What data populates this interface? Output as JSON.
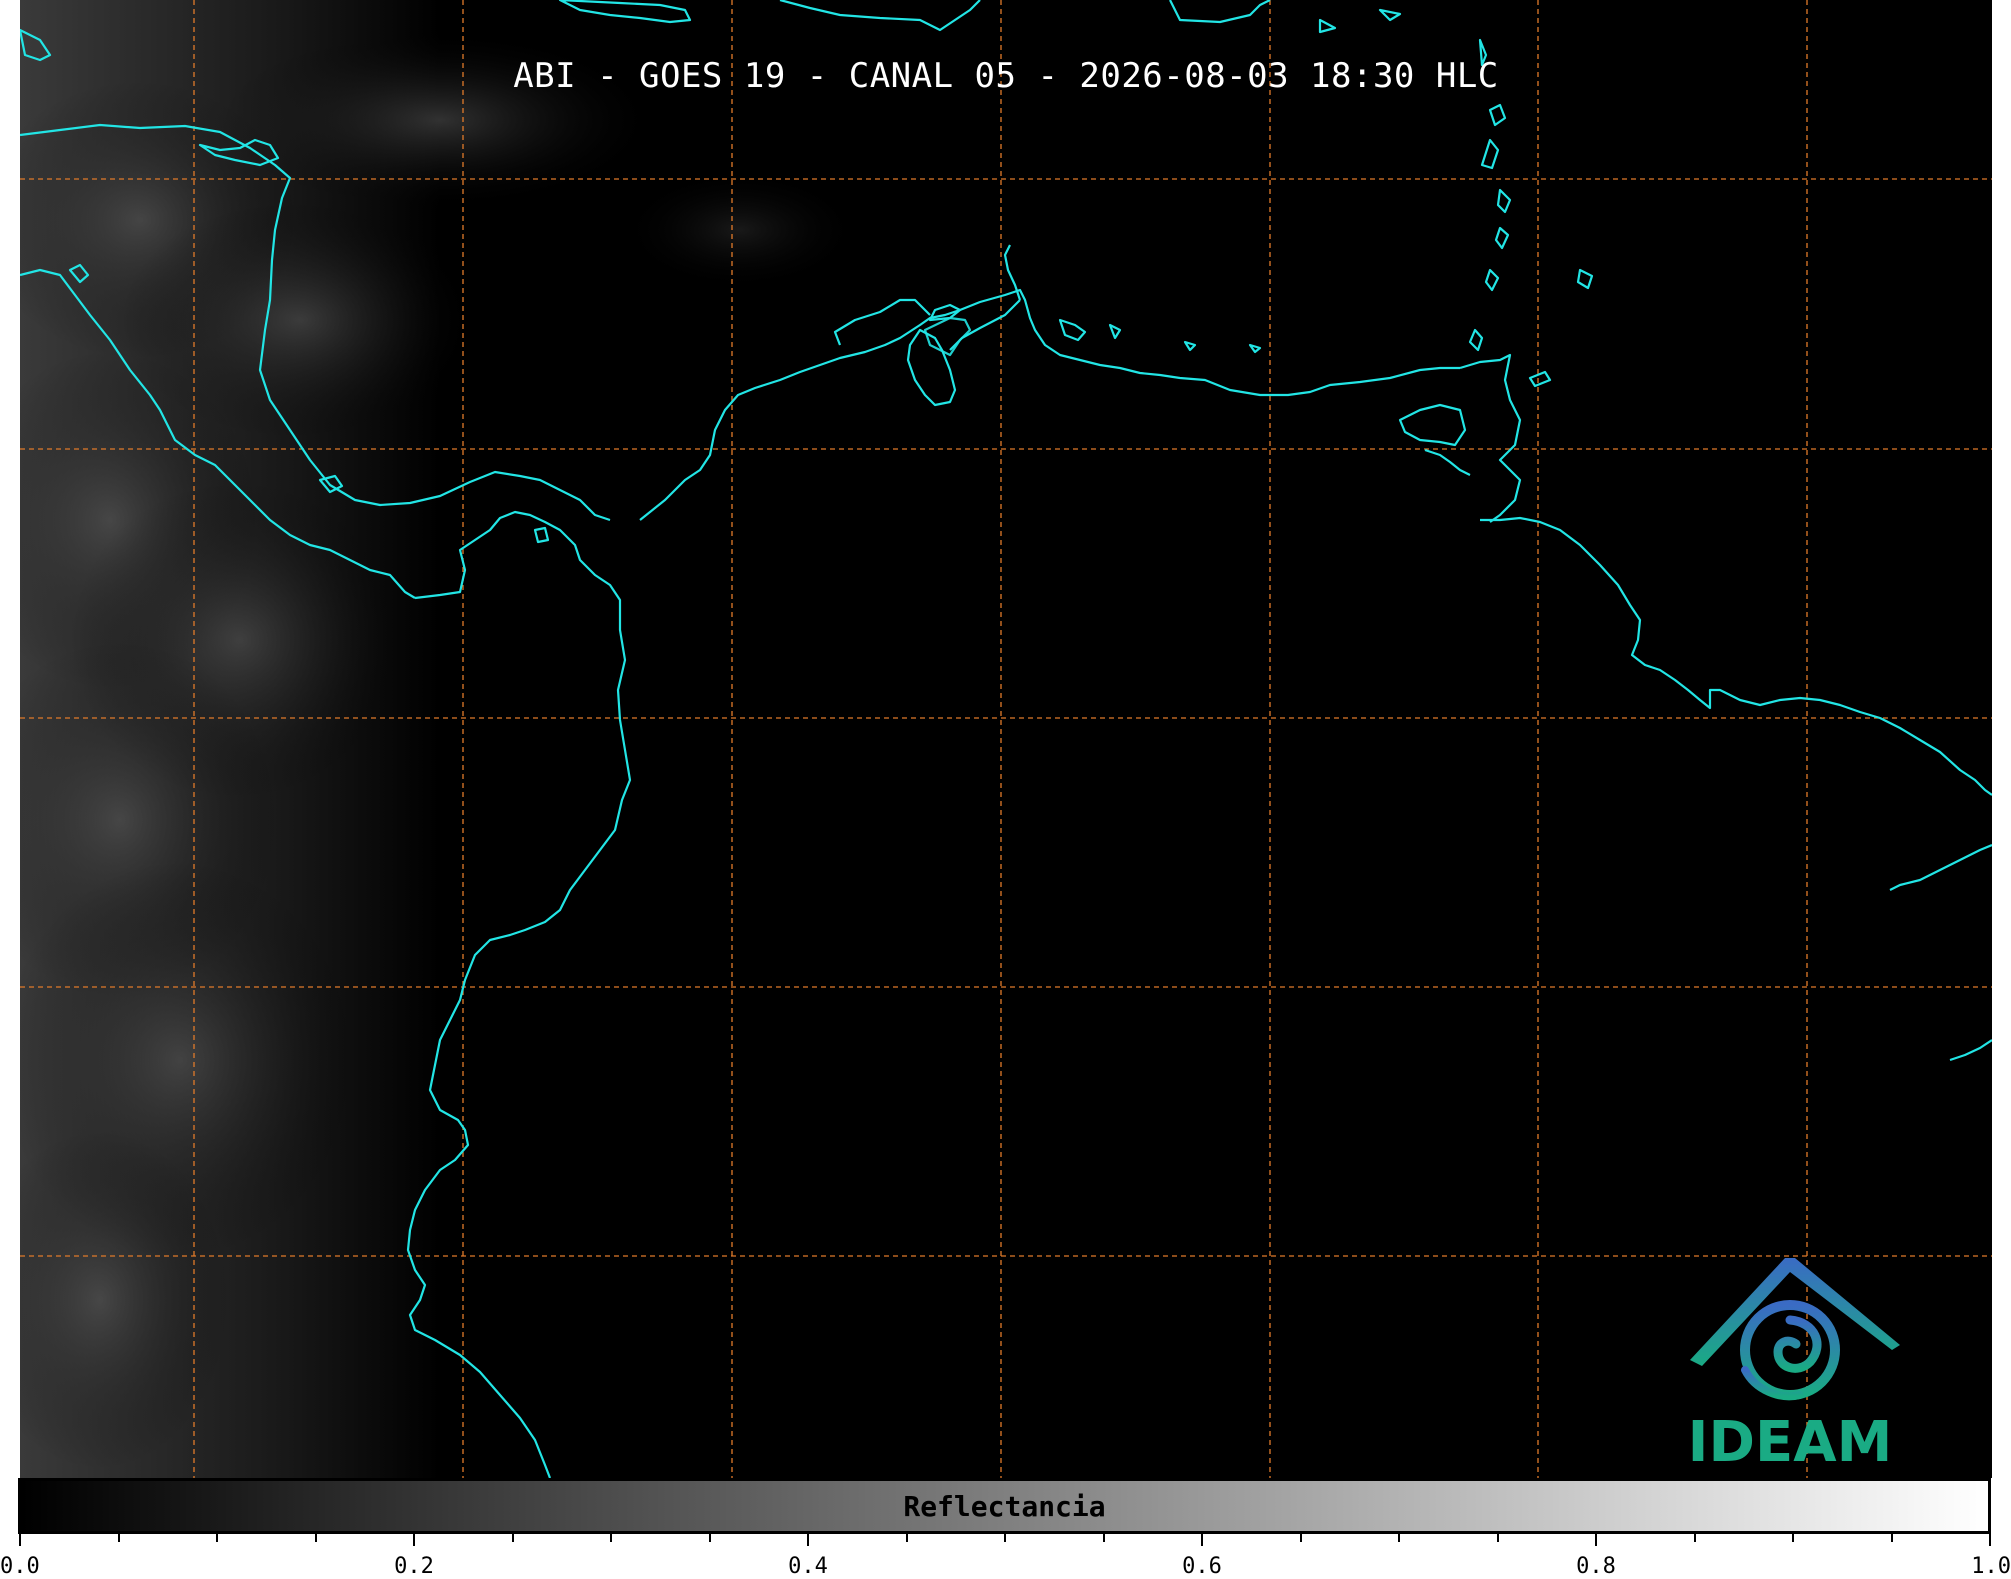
{
  "map": {
    "title": "ABI - GOES 19 - CANAL 05 - 2026-08-03 18:30 HLC",
    "coastline_color": "#22e5e5",
    "gridline_color": "#e07a2a",
    "background_color": "#000000",
    "gridlines": "dashed",
    "imagery": "grayscale reflectance with faint cloud texture on the western edge"
  },
  "logo": {
    "text": "IDEAM",
    "text_color": "#1aab84",
    "mark_color_top": "#3a6bc4",
    "mark_color_bottom": "#1aab84"
  },
  "colorbar": {
    "label": "Reflectancia",
    "range": [
      0.0,
      1.0
    ],
    "colormap": "black-to-white",
    "tick_labels": [
      "0.0",
      "0.2",
      "0.4",
      "0.6",
      "0.8",
      "1.0"
    ],
    "major_ticks": [
      0.0,
      0.2,
      0.4,
      0.6,
      0.8,
      1.0
    ],
    "minor_step": 0.05
  }
}
